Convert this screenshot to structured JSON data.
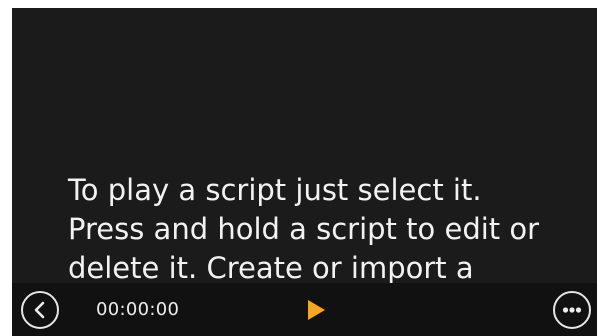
{
  "message": {
    "text": "To play a script just select it.\nPress and hold a script to edit or\ndelete it. Create or import a"
  },
  "bottom_bar": {
    "timer": "00:00:00",
    "back_icon": "chevron-left-icon",
    "play_icon": "play-icon",
    "more_icon": "more-horizontal-icon"
  },
  "colors": {
    "background": "#1b1b1b",
    "bar": "#111111",
    "text": "#f2f2f2",
    "accent": "#f5a623"
  }
}
